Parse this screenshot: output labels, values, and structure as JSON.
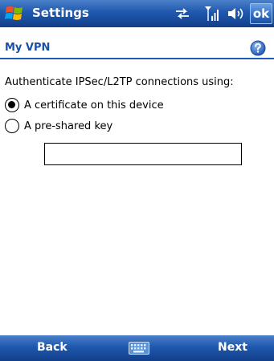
{
  "titlebar": {
    "title": "Settings",
    "ok_label": "ok"
  },
  "header": {
    "title": "My VPN"
  },
  "content": {
    "instruction": "Authenticate IPSec/L2TP connections using:",
    "options": [
      {
        "label": "A certificate on this device",
        "selected": true
      },
      {
        "label": "A pre-shared key",
        "selected": false
      }
    ],
    "key_value": ""
  },
  "softkeys": {
    "left": "Back",
    "right": "Next"
  },
  "colors": {
    "bar_blue": "#1f58ad",
    "header_text": "#1a4fa8",
    "help_icon": "#3a6fc8"
  },
  "icons": [
    "windows-start-icon",
    "connectivity-icon",
    "signal-icon",
    "volume-icon",
    "help-icon",
    "keyboard-icon"
  ]
}
